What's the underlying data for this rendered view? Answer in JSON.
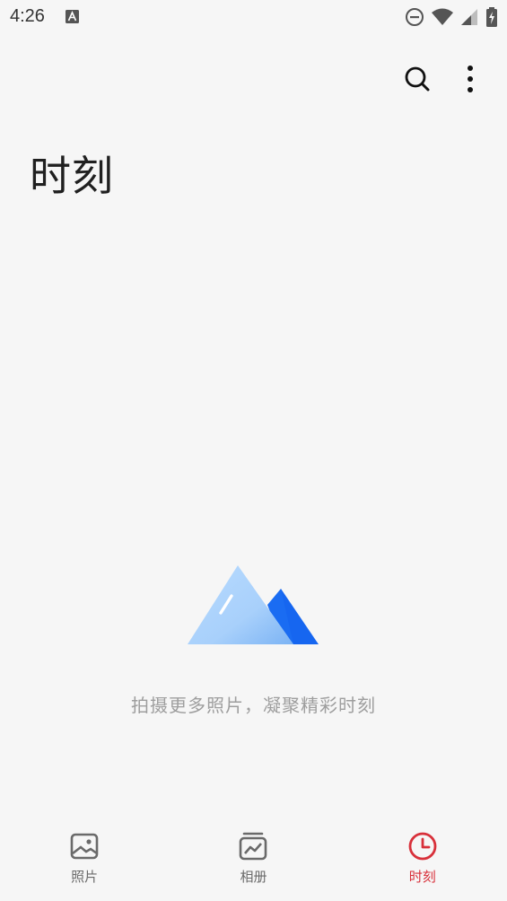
{
  "status_bar": {
    "time": "4:26",
    "icons": [
      "a-notification-icon",
      "do-not-disturb-icon",
      "wifi-icon",
      "signal-icon",
      "battery-icon"
    ]
  },
  "header": {
    "title": "时刻",
    "actions": [
      {
        "name": "search",
        "icon": "search-icon"
      },
      {
        "name": "more",
        "icon": "more-vertical-icon"
      }
    ]
  },
  "empty_state": {
    "illustration": "mountain-icon",
    "message": "拍摄更多照片，凝聚精彩时刻"
  },
  "bottom_nav": {
    "items": [
      {
        "label": "照片",
        "icon": "photo-icon",
        "active": false
      },
      {
        "label": "相册",
        "icon": "album-icon",
        "active": false
      },
      {
        "label": "时刻",
        "icon": "clock-icon",
        "active": true
      }
    ]
  },
  "colors": {
    "background": "#f6f6f6",
    "accent_active": "#d8303a",
    "inactive": "#6a6a6a",
    "hint_text": "#9e9e9e"
  }
}
